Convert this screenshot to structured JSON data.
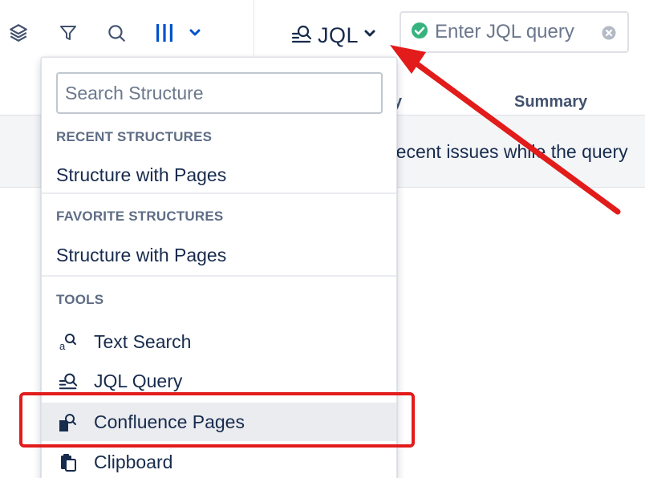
{
  "toolbar": {
    "icons": [
      "layers-icon",
      "filter-icon",
      "search-icon",
      "columns-icon",
      "chevron-down-icon"
    ],
    "accent_color": "#0052cc"
  },
  "jql_switch": {
    "label": "JQL"
  },
  "query_input": {
    "placeholder": "Enter JQL query",
    "status_color": "#36b37e"
  },
  "grid": {
    "header_partial": "y",
    "header_summary": "Summary",
    "message": "recent issues while the query"
  },
  "dropdown": {
    "search_placeholder": "Search Structure",
    "sections": {
      "recent": {
        "title": "RECENT STRUCTURES",
        "items": [
          "Structure with Pages"
        ]
      },
      "favorite": {
        "title": "FAVORITE STRUCTURES",
        "items": [
          "Structure with Pages"
        ]
      },
      "tools": {
        "title": "TOOLS",
        "items": [
          {
            "label": "Text Search",
            "icon": "text-search-icon"
          },
          {
            "label": "JQL Query",
            "icon": "jql-query-icon"
          },
          {
            "label": "Confluence Pages",
            "icon": "confluence-pages-icon",
            "highlighted": true
          },
          {
            "label": "Clipboard",
            "icon": "clipboard-icon"
          }
        ]
      }
    }
  },
  "annotations": {
    "highlight_color": "#e21b1b"
  }
}
